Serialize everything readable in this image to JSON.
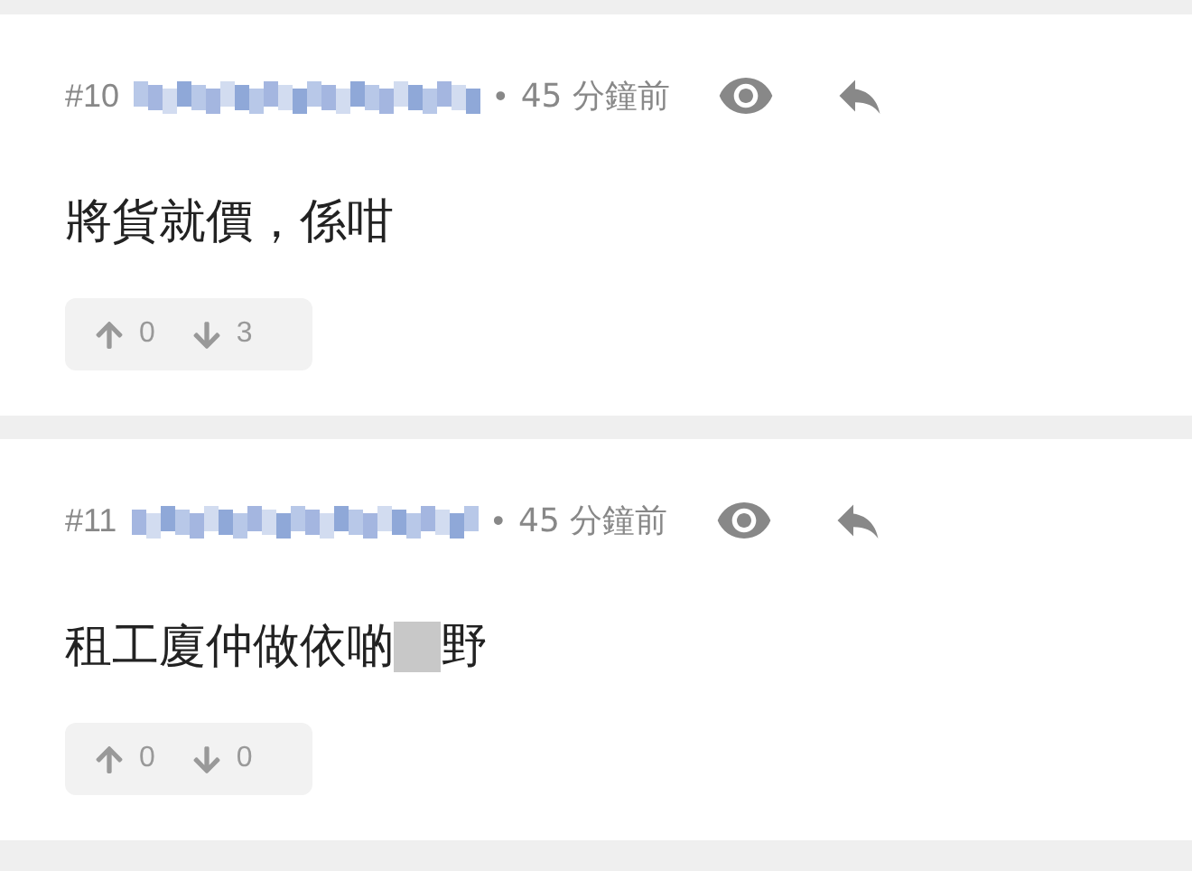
{
  "comments": [
    {
      "number": "#10",
      "separator": "•",
      "time": "45 分鐘前",
      "body_start": "將貨就價，係咁",
      "redacted": false,
      "upvotes": "0",
      "downvotes": "3"
    },
    {
      "number": "#11",
      "separator": "•",
      "time": "45 分鐘前",
      "body_start": "租工廈仲做依啲",
      "redacted": true,
      "body_end": "野",
      "upvotes": "0",
      "downvotes": "0"
    }
  ]
}
